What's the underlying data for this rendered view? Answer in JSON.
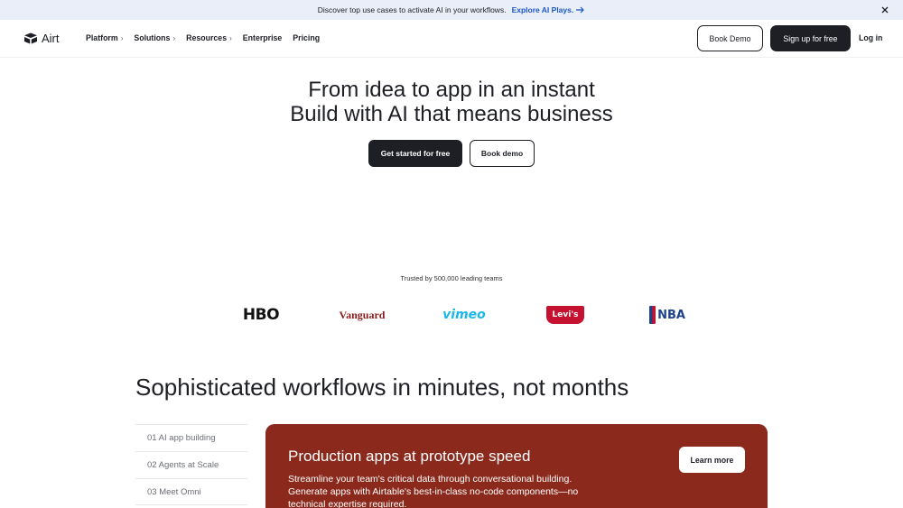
{
  "announcement": {
    "text": "Discover top use cases to activate AI in your workflows.",
    "link": "Explore AI Plays."
  },
  "header": {
    "logo_text": "Airt",
    "nav": [
      {
        "label": "Platform",
        "has_chevron": true
      },
      {
        "label": "Solutions",
        "has_chevron": true
      },
      {
        "label": "Resources",
        "has_chevron": true
      },
      {
        "label": "Enterprise",
        "has_chevron": false
      },
      {
        "label": "Pricing",
        "has_chevron": false
      }
    ],
    "book_demo": "Book Demo",
    "sign_up": "Sign up for free",
    "log_in": "Log in"
  },
  "hero": {
    "line1": "From idea to app in an instant",
    "line2": "Build with AI that means business",
    "primary_cta": "Get started for free",
    "secondary_cta": "Book demo"
  },
  "trusted": {
    "text": "Trusted by 500,000 leading teams",
    "logos": [
      "HBO",
      "Vanguard",
      "vimeo",
      "Levi's",
      "NBA"
    ]
  },
  "workflows": {
    "title": "Sophisticated workflows in minutes, not months",
    "tabs": [
      "01 AI app building",
      "02 Agents at Scale",
      "03 Meet Omni"
    ],
    "card": {
      "title": "Production apps at prototype speed",
      "body": "Streamline your team's critical data through conversational building. Generate apps with Airtable's best-in-class no-code components—no technical expertise required.",
      "button": "Learn more",
      "color": "#8b2a1c"
    }
  },
  "colors": {
    "accent_link": "#1a56c7",
    "dark_button": "#1d1f25",
    "announce_bg": "#e9eef8"
  }
}
